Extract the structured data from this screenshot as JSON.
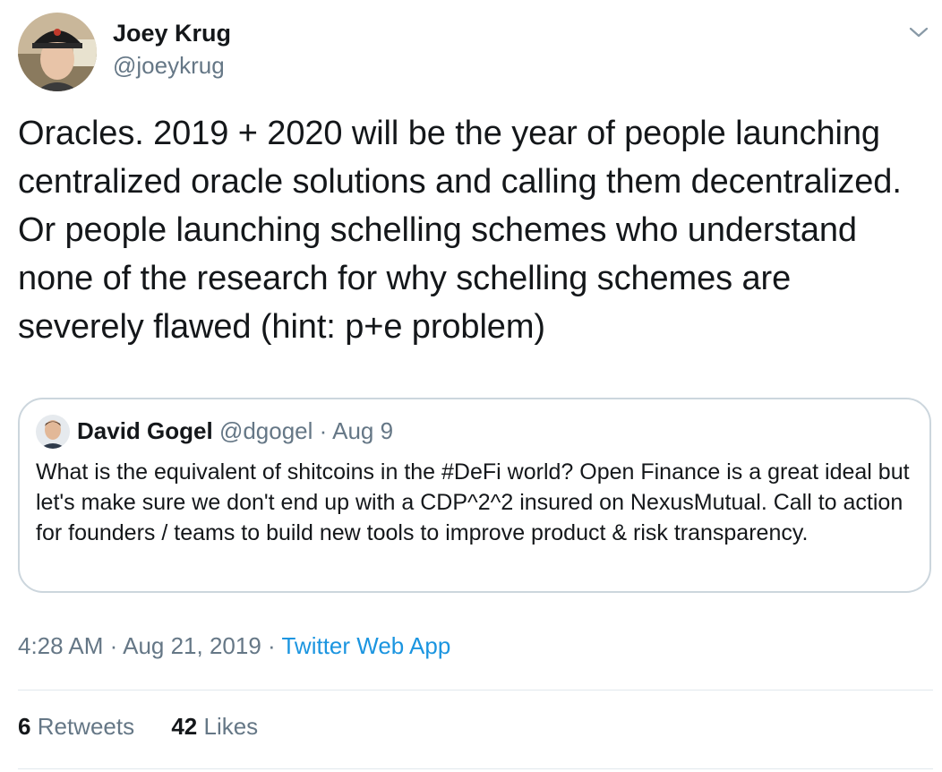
{
  "author": {
    "name": "Joey Krug",
    "handle": "@joeykrug"
  },
  "tweet": {
    "text": "Oracles. 2019 + 2020 will be the year of people launching centralized oracle solutions and calling them decentralized. Or people launching schelling schemes who understand none of the research for why schelling schemes are severely flawed (hint: p+e problem)"
  },
  "quoted": {
    "name": "David Gogel",
    "handle": "@dgogel",
    "separator": "·",
    "date": "Aug 9",
    "text": "What is the equivalent of shitcoins in the #DeFi world? Open Finance is a great ideal but let's make sure we don't end up with a CDP^2^2 insured on NexusMutual. Call to action for founders / teams to build new tools to improve product & risk transparency."
  },
  "meta": {
    "time": "4:28 AM",
    "separator": "·",
    "date": "Aug 21, 2019",
    "source": "Twitter Web App"
  },
  "stats": {
    "retweets_count": "6",
    "retweets_label": "Retweets",
    "likes_count": "42",
    "likes_label": "Likes"
  },
  "icons": {
    "menu": "chevron-down-icon"
  },
  "colors": {
    "text": "#14171a",
    "secondary": "#657786",
    "link": "#1b95e0",
    "border": "#ccd6dd"
  }
}
